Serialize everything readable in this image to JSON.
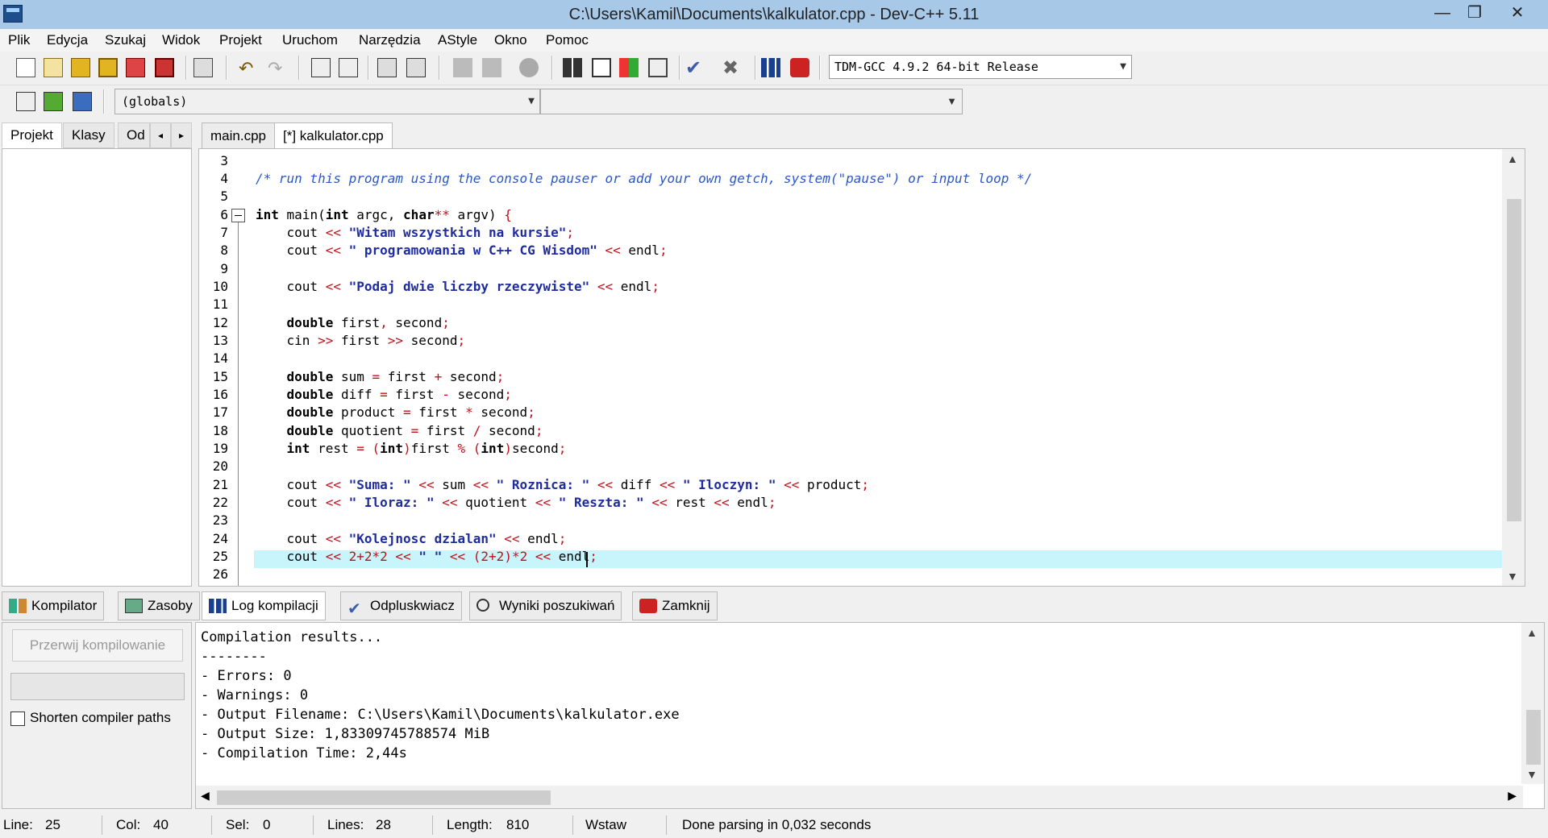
{
  "window": {
    "title": "C:\\Users\\Kamil\\Documents\\kalkulator.cpp - Dev-C++ 5.11"
  },
  "menu": [
    "Plik",
    "Edycja",
    "Szukaj",
    "Widok",
    "Projekt",
    "Uruchom",
    "Narzędzia",
    "AStyle",
    "Okno",
    "Pomoc"
  ],
  "toolbar": {
    "compiler": "TDM-GCC 4.9.2 64-bit Release",
    "scope": "(globals)",
    "function": ""
  },
  "left_tabs": [
    "Projekt",
    "Klasy",
    "Od"
  ],
  "editor_tabs": [
    "main.cpp",
    "[*] kalkulator.cpp"
  ],
  "editor": {
    "line_numbers": [
      "3",
      "4",
      "5",
      "6",
      "7",
      "8",
      "9",
      "10",
      "11",
      "12",
      "13",
      "14",
      "15",
      "16",
      "17",
      "18",
      "19",
      "20",
      "21",
      "22",
      "23",
      "24",
      "25",
      "26"
    ],
    "current_line": 25
  },
  "bottom_tabs": [
    "Kompilator",
    "Zasoby",
    "Log kompilacji",
    "Odpluskwiacz",
    "Wyniki poszukiwań",
    "Zamknij"
  ],
  "compile_panel": {
    "abort_label": "Przerwij kompilowanie",
    "shorten_label": "Shorten compiler paths"
  },
  "log_lines": [
    "Compilation results...",
    "--------",
    "- Errors: 0",
    "- Warnings: 0",
    "- Output Filename: C:\\Users\\Kamil\\Documents\\kalkulator.exe",
    "- Output Size: 1,83309745788574 MiB",
    "- Compilation Time: 2,44s"
  ],
  "status": {
    "line_label": "Line:",
    "line": "25",
    "col_label": "Col:",
    "col": "40",
    "sel_label": "Sel:",
    "sel": "0",
    "lines_label": "Lines:",
    "lines": "28",
    "length_label": "Length:",
    "length": "810",
    "mode": "Wstaw",
    "message": "Done parsing in 0,032 seconds"
  }
}
